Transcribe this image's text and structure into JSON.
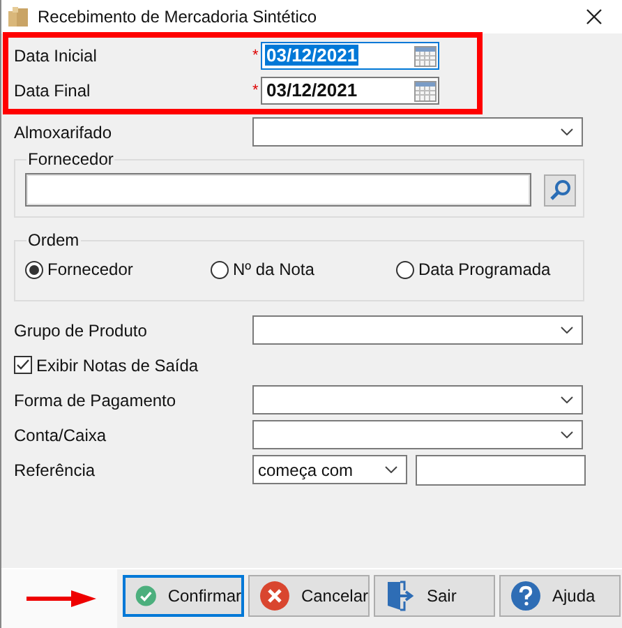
{
  "window": {
    "title": "Recebimento de Mercadoria Sintético"
  },
  "date_fields": [
    {
      "label": "Data Inicial",
      "required_mark": "*",
      "value": "03/12/2021",
      "focused": true
    },
    {
      "label": "Data Final",
      "required_mark": "*",
      "value": "03/12/2021",
      "focused": false
    }
  ],
  "almoxarifado": {
    "label": "Almoxarifado"
  },
  "fornecedor": {
    "legend": "Fornecedor"
  },
  "ordem": {
    "legend": "Ordem",
    "options": [
      {
        "label": "Fornecedor",
        "selected": true
      },
      {
        "label": "Nº da Nota",
        "selected": false
      },
      {
        "label": "Data Programada",
        "selected": false
      }
    ]
  },
  "fields": [
    {
      "kind": "combo",
      "label": "Grupo de Produto"
    },
    {
      "kind": "checkbox",
      "label": "Exibir Notas de Saída",
      "checked": true
    },
    {
      "kind": "combo",
      "label": "Forma de Pagamento"
    },
    {
      "kind": "combo",
      "label": "Conta/Caixa"
    },
    {
      "kind": "reference",
      "label": "Referência",
      "operator": "começa com"
    }
  ],
  "buttons": [
    {
      "kind": "confirm",
      "label": "Confirmar",
      "focused": true
    },
    {
      "kind": "cancel",
      "label": "Cancelar",
      "focused": false
    },
    {
      "kind": "exit",
      "label": "Sair",
      "focused": false
    },
    {
      "kind": "help",
      "label": "Ajuda",
      "focused": false
    }
  ]
}
